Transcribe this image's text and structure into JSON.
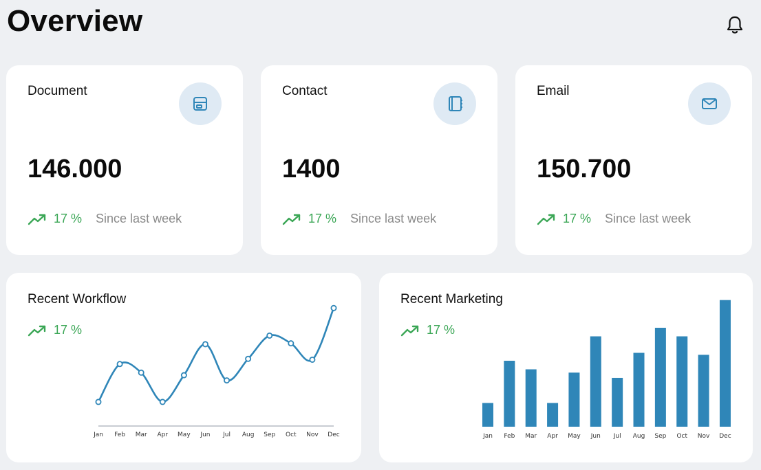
{
  "header": {
    "title": "Overview",
    "notifications_icon": "bell-icon"
  },
  "stats": [
    {
      "label": "Document",
      "icon": "document-icon",
      "value": "146.000",
      "trend_pct": "17 %",
      "trend_text": "Since last week"
    },
    {
      "label": "Contact",
      "icon": "contact-book-icon",
      "value": "1400",
      "trend_pct": "17 %",
      "trend_text": "Since last week"
    },
    {
      "label": "Email",
      "icon": "mail-icon",
      "value": "150.700",
      "trend_pct": "17 %",
      "trend_text": "Since last week"
    }
  ],
  "workflow": {
    "title": "Recent Workflow",
    "trend_pct": "17 %"
  },
  "marketing": {
    "title": "Recent Marketing",
    "trend_pct": "17 %"
  },
  "colors": {
    "accent": "#2f86b8",
    "trend_green": "#3aa655",
    "icon_bg": "#dfeaf4",
    "page_bg": "#eef0f3"
  },
  "chart_data": [
    {
      "type": "line",
      "categories": [
        "Jan",
        "Feb",
        "Mar",
        "Apr",
        "May",
        "Jun",
        "Jul",
        "Aug",
        "Sep",
        "Oct",
        "Nov",
        "Dec"
      ],
      "values": [
        28,
        72,
        62,
        28,
        59,
        95,
        53,
        78,
        105,
        96,
        77,
        137
      ],
      "ylim": [
        0,
        150
      ],
      "grid": false
    },
    {
      "type": "bar",
      "categories": [
        "Jan",
        "Feb",
        "Mar",
        "Apr",
        "May",
        "Jun",
        "Jul",
        "Aug",
        "Sep",
        "Oct",
        "Nov",
        "Dec"
      ],
      "values": [
        36,
        100,
        87,
        36,
        82,
        137,
        74,
        112,
        150,
        137,
        109,
        192
      ],
      "ylim": [
        0,
        200
      ],
      "grid": false
    }
  ]
}
